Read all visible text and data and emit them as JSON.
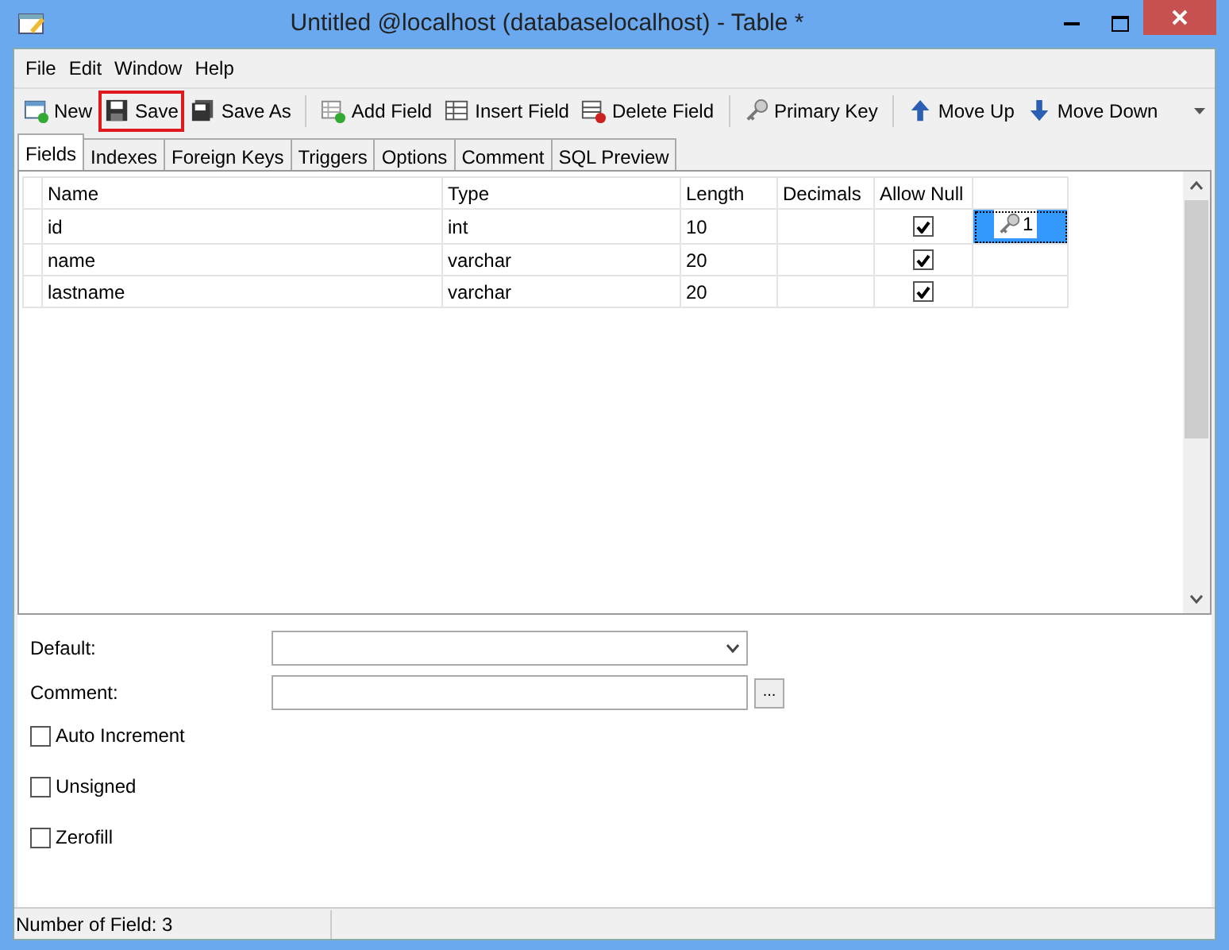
{
  "window": {
    "title": "Untitled @localhost (databaselocalhost) - Table *"
  },
  "menu": [
    "File",
    "Edit",
    "Window",
    "Help"
  ],
  "toolbar": [
    [
      {
        "label": "New",
        "kind": "new",
        "highlighted": false
      },
      {
        "label": "Save",
        "kind": "save",
        "highlighted": true
      },
      {
        "label": "Save As",
        "kind": "saveas",
        "highlighted": false
      }
    ],
    [
      {
        "label": "Add Field",
        "kind": "add",
        "highlighted": false
      },
      {
        "label": "Insert Field",
        "kind": "insert",
        "highlighted": false
      },
      {
        "label": "Delete Field",
        "kind": "delete",
        "highlighted": false
      }
    ],
    [
      {
        "label": "Primary Key",
        "kind": "key",
        "highlighted": false
      }
    ],
    [
      {
        "label": "Move Up",
        "kind": "up",
        "highlighted": false
      },
      {
        "label": "Move Down",
        "kind": "down",
        "highlighted": false
      }
    ]
  ],
  "tabs": [
    {
      "label": "Fields",
      "selected": true
    },
    {
      "label": "Indexes",
      "selected": false
    },
    {
      "label": "Foreign Keys",
      "selected": false
    },
    {
      "label": "Triggers",
      "selected": false
    },
    {
      "label": "Options",
      "selected": false
    },
    {
      "label": "Comment",
      "selected": false
    },
    {
      "label": "SQL Preview",
      "selected": false
    }
  ],
  "table": {
    "columns": [
      "Name",
      "Type",
      "Length",
      "Decimals",
      "Allow Null"
    ],
    "rows": [
      {
        "name": "id",
        "type": "int",
        "length": "10",
        "allow_null": true,
        "key": "1",
        "selected": true
      },
      {
        "name": "name",
        "type": "varchar",
        "length": "20",
        "allow_null": true,
        "selected": false
      },
      {
        "name": "lastname",
        "type": "varchar",
        "length": "20",
        "allow_null": true,
        "selected": false
      }
    ]
  },
  "form": {
    "default_label": "Default:",
    "comment_label": "Comment:",
    "comment_button": "...",
    "options": [
      {
        "label": "Auto Increment",
        "checked": false
      },
      {
        "label": "Unsigned",
        "checked": false
      },
      {
        "label": "Zerofill",
        "checked": false
      }
    ]
  },
  "status_bar": "Number of Field: 3"
}
